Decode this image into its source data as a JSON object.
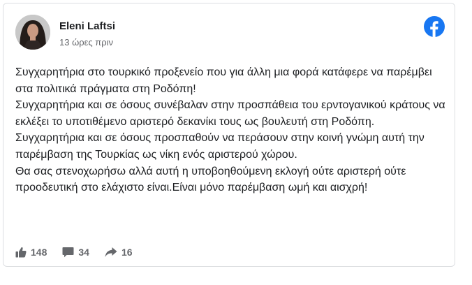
{
  "post": {
    "author": "Eleni Laftsi",
    "timestamp": "13 ώρες πριν",
    "paragraphs": [
      "Συγχαρητήρια στο τουρκικό προξενείο που για άλλη μια φορά κατάφερε να παρέμβει στα πολιτικά πράγματα στη Ροδόπη!",
      "Συγχαρητήρια και σε όσους συνέβαλαν στην προσπάθεια του ερντογανικού κράτους να εκλέξει το υποτιθέμενο αριστερό δεκανίκι τους ως βουλευτή στη Ροδόπη.",
      "Συγχαρητήρια και σε όσους προσπαθούν να περάσουν στην κοινή γνώμη αυτή την παρέμβαση της Τουρκίας ως νίκη ενός αριστερού χώρου.",
      "Θα σας στενοχωρήσω αλλά αυτή η υποβοηθούμενη εκλογή ούτε αριστερή ούτε προοδευτική στο ελάχιστο είναι.Είναι μόνο παρέμβαση ωμή και αισχρή!"
    ]
  },
  "stats": {
    "likes": "148",
    "comments": "34",
    "shares": "16"
  },
  "icons": {
    "brand": "facebook-icon",
    "likes": "thumbs-up-icon",
    "comments": "comment-icon",
    "shares": "share-arrow-icon"
  },
  "colors": {
    "facebook_blue": "#1877f2",
    "text": "#1c1e21",
    "muted": "#65676b",
    "border": "#dddfe2"
  }
}
